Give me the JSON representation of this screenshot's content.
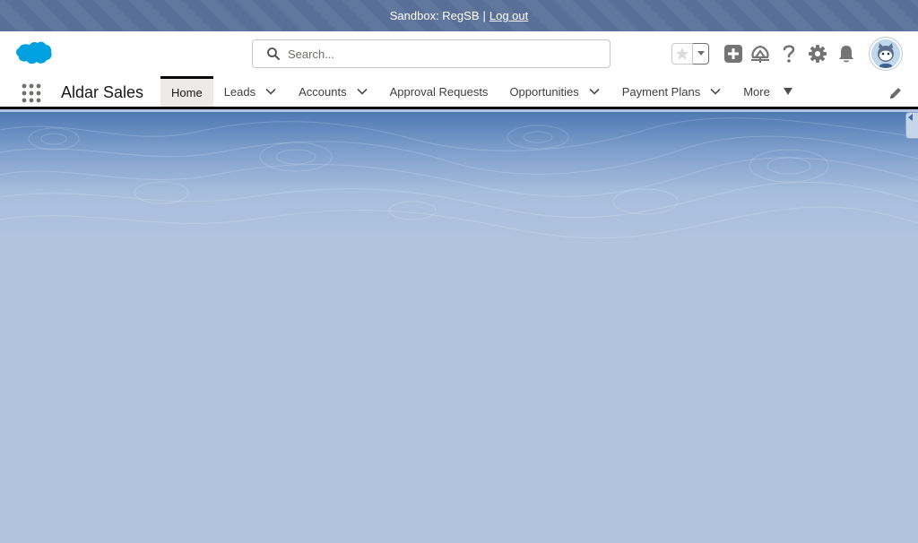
{
  "sandbox": {
    "label": "Sandbox: RegSB",
    "separator": "|",
    "logout": "Log out"
  },
  "header": {
    "search_placeholder": "Search..."
  },
  "nav": {
    "app_name": "Aldar Sales",
    "items": [
      {
        "label": "Home",
        "active": true,
        "dropdown": false
      },
      {
        "label": "Leads",
        "active": false,
        "dropdown": true
      },
      {
        "label": "Accounts",
        "active": false,
        "dropdown": true
      },
      {
        "label": "Approval Requests",
        "active": false,
        "dropdown": false
      },
      {
        "label": "Opportunities",
        "active": false,
        "dropdown": true
      },
      {
        "label": "Payment Plans",
        "active": false,
        "dropdown": true
      }
    ],
    "more": "More"
  },
  "icons": [
    "salesforce-cloud-icon",
    "search-icon",
    "star-icon",
    "chevron-down-icon",
    "add-icon",
    "trailhead-icon",
    "help-icon",
    "gear-icon",
    "bell-icon",
    "avatar",
    "app-launcher-icon",
    "pencil-icon"
  ],
  "colors": {
    "brand": "#00a1e0",
    "banner": "#5a6f97",
    "background": "#b0c4df",
    "icon_gray": "#747474"
  }
}
